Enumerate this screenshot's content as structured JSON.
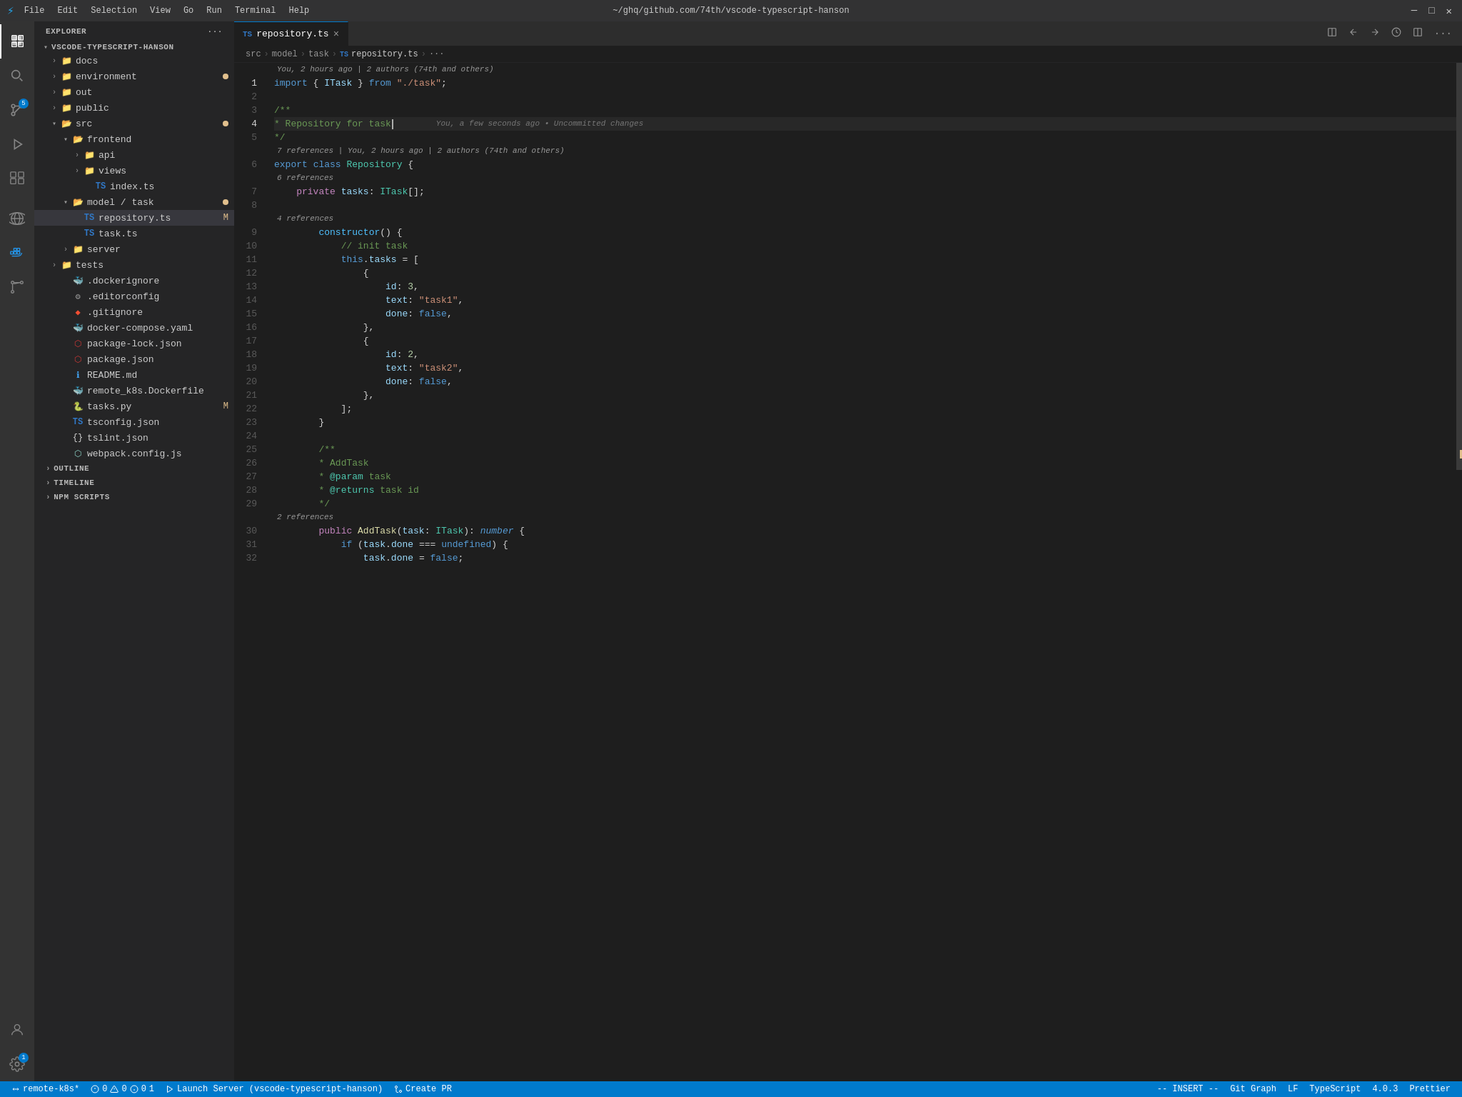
{
  "titleBar": {
    "icon": "⚡",
    "menuItems": [
      "File",
      "Edit",
      "Selection",
      "View",
      "Go",
      "Run",
      "Terminal",
      "Help"
    ],
    "title": "~/ghq/github.com/74th/vscode-typescript-hanson",
    "windowControls": [
      "─",
      "□",
      "✕"
    ]
  },
  "activityBar": {
    "icons": [
      {
        "name": "explorer-icon",
        "symbol": "⬡",
        "active": true
      },
      {
        "name": "search-icon",
        "symbol": "🔍",
        "active": false
      },
      {
        "name": "source-control-icon",
        "symbol": "⑂",
        "active": false,
        "badge": "5"
      },
      {
        "name": "run-icon",
        "symbol": "▷",
        "active": false
      },
      {
        "name": "extensions-icon",
        "symbol": "⊞",
        "active": false
      },
      {
        "name": "database-icon",
        "symbol": "⊗",
        "active": false
      },
      {
        "name": "docker-icon",
        "symbol": "🐳",
        "active": false
      },
      {
        "name": "git-graph-icon",
        "symbol": "⑂",
        "active": false
      }
    ],
    "bottomIcons": [
      {
        "name": "account-icon",
        "symbol": "👤"
      },
      {
        "name": "settings-icon",
        "symbol": "⚙",
        "badge": "1"
      }
    ]
  },
  "sidebar": {
    "header": "Explorer",
    "headerDots": "···",
    "rootFolder": "VSCODE-TYPESCRIPT-HANSON",
    "tree": [
      {
        "type": "folder",
        "name": "docs",
        "level": 1,
        "expanded": false
      },
      {
        "type": "folder",
        "name": "environment",
        "level": 1,
        "expanded": false,
        "dotModified": true
      },
      {
        "type": "folder",
        "name": "out",
        "level": 1,
        "expanded": false
      },
      {
        "type": "folder",
        "name": "public",
        "level": 1,
        "expanded": false
      },
      {
        "type": "folder",
        "name": "src",
        "level": 1,
        "expanded": true,
        "dotModified": true
      },
      {
        "type": "folder",
        "name": "frontend",
        "level": 2,
        "expanded": true
      },
      {
        "type": "folder",
        "name": "api",
        "level": 3,
        "expanded": false
      },
      {
        "type": "folder",
        "name": "views",
        "level": 3,
        "expanded": false
      },
      {
        "type": "file",
        "name": "index.ts",
        "icon": "ts",
        "level": 3
      },
      {
        "type": "folder",
        "name": "model / task",
        "level": 2,
        "expanded": true,
        "dotModified": true
      },
      {
        "type": "file",
        "name": "repository.ts",
        "icon": "ts",
        "level": 3,
        "active": true,
        "modified": "M"
      },
      {
        "type": "file",
        "name": "task.ts",
        "icon": "ts",
        "level": 3
      },
      {
        "type": "folder",
        "name": "server",
        "level": 2,
        "expanded": false
      },
      {
        "type": "folder",
        "name": "tests",
        "level": 1,
        "expanded": false
      },
      {
        "type": "file",
        "name": ".dockerignore",
        "icon": "docker",
        "level": 1
      },
      {
        "type": "file",
        "name": ".editorconfig",
        "icon": "gear",
        "level": 1
      },
      {
        "type": "file",
        "name": ".gitignore",
        "icon": "git",
        "level": 1
      },
      {
        "type": "file",
        "name": "docker-compose.yaml",
        "icon": "docker",
        "level": 1
      },
      {
        "type": "file",
        "name": "package-lock.json",
        "icon": "pkg",
        "level": 1
      },
      {
        "type": "file",
        "name": "package.json",
        "icon": "pkg",
        "level": 1
      },
      {
        "type": "file",
        "name": "README.md",
        "icon": "md",
        "level": 1
      },
      {
        "type": "file",
        "name": "remote_k8s.Dockerfile",
        "icon": "docker",
        "level": 1
      },
      {
        "type": "file",
        "name": "tasks.py",
        "icon": "py",
        "level": 1,
        "modified": "M"
      },
      {
        "type": "file",
        "name": "tsconfig.json",
        "icon": "ts",
        "level": 1
      },
      {
        "type": "file",
        "name": "tslint.json",
        "icon": "braces",
        "level": 1
      },
      {
        "type": "file",
        "name": "webpack.config.js",
        "icon": "webpack",
        "level": 1
      }
    ],
    "sections": [
      {
        "name": "OUTLINE"
      },
      {
        "name": "TIMELINE"
      },
      {
        "name": "NPM SCRIPTS"
      }
    ]
  },
  "editor": {
    "tab": {
      "icon": "ts",
      "name": "repository.ts",
      "close": "×"
    },
    "breadcrumb": [
      "src",
      ">",
      "model",
      ">",
      "task",
      ">",
      "repository.ts",
      ">",
      "···"
    ],
    "blameInfo1": "You, 2 hours ago | 2 authors (74th and others)",
    "blameInfo2": "7 references | You, 2 hours ago | 2 authors (74th and others)",
    "blameInfo3": "6 references",
    "blameInfo4": "4 references",
    "blameInfo5": "2 references",
    "activeLineBlame": "You, a few seconds ago • Uncommitted changes",
    "lines": [
      {
        "num": 1,
        "tokens": [
          {
            "t": "kw",
            "v": "import"
          },
          {
            "t": "plain",
            "v": " { "
          },
          {
            "t": "prop",
            "v": "ITask"
          },
          {
            "t": "plain",
            "v": " } "
          },
          {
            "t": "kw",
            "v": "from"
          },
          {
            "t": "plain",
            "v": " "
          },
          {
            "t": "str",
            "v": "\"./task\""
          },
          {
            "t": "plain",
            "v": ";"
          }
        ]
      },
      {
        "num": 2,
        "tokens": []
      },
      {
        "num": 3,
        "tokens": [
          {
            "t": "cmt",
            "v": "/**"
          }
        ]
      },
      {
        "num": 4,
        "tokens": [
          {
            "t": "cmt",
            "v": "* Repository for task"
          },
          {
            "t": "cursor",
            "v": ""
          },
          {
            "t": "plain",
            "v": "    "
          },
          {
            "t": "git-blame",
            "v": "You, a few seconds ago • Uncommitted changes"
          }
        ],
        "active": true
      },
      {
        "num": 5,
        "tokens": [
          {
            "t": "cmt",
            "v": "*/"
          }
        ]
      },
      {
        "num": 6,
        "tokens": [
          {
            "t": "kw",
            "v": "export"
          },
          {
            "t": "plain",
            "v": " "
          },
          {
            "t": "kw",
            "v": "class"
          },
          {
            "t": "plain",
            "v": " "
          },
          {
            "t": "cls",
            "v": "Repository"
          },
          {
            "t": "plain",
            "v": " {"
          }
        ]
      },
      {
        "num": 7,
        "tokens": [
          {
            "t": "plain",
            "v": "    "
          },
          {
            "t": "kw2",
            "v": "private"
          },
          {
            "t": "plain",
            "v": " "
          },
          {
            "t": "prop",
            "v": "tasks"
          },
          {
            "t": "plain",
            "v": ": "
          },
          {
            "t": "cls",
            "v": "ITask"
          },
          {
            "t": "plain",
            "v": "[];"
          }
        ]
      },
      {
        "num": 8,
        "tokens": []
      },
      {
        "num": 9,
        "tokens": [
          {
            "t": "plain",
            "v": "        "
          },
          {
            "t": "dec",
            "v": "constructor"
          },
          {
            "t": "plain",
            "v": "() {"
          }
        ]
      },
      {
        "num": 10,
        "tokens": [
          {
            "t": "plain",
            "v": "            "
          },
          {
            "t": "cmt",
            "v": "// init task"
          }
        ]
      },
      {
        "num": 11,
        "tokens": [
          {
            "t": "plain",
            "v": "            "
          },
          {
            "t": "kw",
            "v": "this"
          },
          {
            "t": "plain",
            "v": "."
          },
          {
            "t": "prop",
            "v": "tasks"
          },
          {
            "t": "plain",
            "v": " = ["
          }
        ]
      },
      {
        "num": 12,
        "tokens": [
          {
            "t": "plain",
            "v": "                {"
          }
        ]
      },
      {
        "num": 13,
        "tokens": [
          {
            "t": "plain",
            "v": "                    "
          },
          {
            "t": "prop",
            "v": "id"
          },
          {
            "t": "plain",
            "v": ": "
          },
          {
            "t": "num",
            "v": "3"
          },
          {
            "t": "plain",
            "v": ","
          }
        ]
      },
      {
        "num": 14,
        "tokens": [
          {
            "t": "plain",
            "v": "                    "
          },
          {
            "t": "prop",
            "v": "text"
          },
          {
            "t": "plain",
            "v": ": "
          },
          {
            "t": "str",
            "v": "\"task1\""
          },
          {
            "t": "plain",
            "v": ","
          }
        ]
      },
      {
        "num": 15,
        "tokens": [
          {
            "t": "plain",
            "v": "                    "
          },
          {
            "t": "prop",
            "v": "done"
          },
          {
            "t": "plain",
            "v": ": "
          },
          {
            "t": "kw",
            "v": "false"
          },
          {
            "t": "plain",
            "v": ","
          }
        ]
      },
      {
        "num": 16,
        "tokens": [
          {
            "t": "plain",
            "v": "                },"
          }
        ]
      },
      {
        "num": 17,
        "tokens": [
          {
            "t": "plain",
            "v": "                {"
          }
        ]
      },
      {
        "num": 18,
        "tokens": [
          {
            "t": "plain",
            "v": "                    "
          },
          {
            "t": "prop",
            "v": "id"
          },
          {
            "t": "plain",
            "v": ": "
          },
          {
            "t": "num",
            "v": "2"
          },
          {
            "t": "plain",
            "v": ","
          }
        ]
      },
      {
        "num": 19,
        "tokens": [
          {
            "t": "plain",
            "v": "                    "
          },
          {
            "t": "prop",
            "v": "text"
          },
          {
            "t": "plain",
            "v": ": "
          },
          {
            "t": "str",
            "v": "\"task2\""
          },
          {
            "t": "plain",
            "v": ","
          }
        ]
      },
      {
        "num": 20,
        "tokens": [
          {
            "t": "plain",
            "v": "                    "
          },
          {
            "t": "prop",
            "v": "done"
          },
          {
            "t": "plain",
            "v": ": "
          },
          {
            "t": "kw",
            "v": "false"
          },
          {
            "t": "plain",
            "v": ","
          }
        ]
      },
      {
        "num": 21,
        "tokens": [
          {
            "t": "plain",
            "v": "                },"
          }
        ]
      },
      {
        "num": 22,
        "tokens": [
          {
            "t": "plain",
            "v": "            ];"
          }
        ]
      },
      {
        "num": 23,
        "tokens": [
          {
            "t": "plain",
            "v": "        }"
          }
        ]
      },
      {
        "num": 24,
        "tokens": []
      },
      {
        "num": 25,
        "tokens": [
          {
            "t": "plain",
            "v": "        "
          },
          {
            "t": "cmt",
            "v": "/**"
          }
        ]
      },
      {
        "num": 26,
        "tokens": [
          {
            "t": "plain",
            "v": "        "
          },
          {
            "t": "cmt",
            "v": "* AddTask"
          }
        ]
      },
      {
        "num": 27,
        "tokens": [
          {
            "t": "plain",
            "v": "        "
          },
          {
            "t": "cmt",
            "v": "* "
          },
          {
            "t": "cmt",
            "v": "@param"
          },
          {
            "t": "cmt",
            "v": " task"
          }
        ]
      },
      {
        "num": 28,
        "tokens": [
          {
            "t": "plain",
            "v": "        "
          },
          {
            "t": "cmt",
            "v": "* "
          },
          {
            "t": "cmt",
            "v": "@returns"
          },
          {
            "t": "cmt",
            "v": " task id"
          }
        ]
      },
      {
        "num": 29,
        "tokens": [
          {
            "t": "plain",
            "v": "        "
          },
          {
            "t": "cmt",
            "v": "*/"
          }
        ]
      },
      {
        "num": 30,
        "tokens": [
          {
            "t": "plain",
            "v": "        "
          },
          {
            "t": "kw2",
            "v": "public"
          },
          {
            "t": "plain",
            "v": " "
          },
          {
            "t": "fn",
            "v": "AddTask"
          },
          {
            "t": "plain",
            "v": "("
          },
          {
            "t": "param",
            "v": "task"
          },
          {
            "t": "plain",
            "v": ": "
          },
          {
            "t": "cls",
            "v": "ITask"
          },
          {
            "t": "plain",
            "v": "): "
          },
          {
            "t": "ret",
            "v": "number"
          },
          {
            "t": "plain",
            "v": " {"
          }
        ]
      },
      {
        "num": 31,
        "tokens": [
          {
            "t": "plain",
            "v": "            "
          },
          {
            "t": "kw",
            "v": "if"
          },
          {
            "t": "plain",
            "v": " ("
          },
          {
            "t": "prop",
            "v": "task"
          },
          {
            "t": "plain",
            "v": "."
          },
          {
            "t": "prop",
            "v": "done"
          },
          {
            "t": "plain",
            "v": " "
          },
          {
            "t": "op",
            "v": "==="
          },
          {
            "t": "plain",
            "v": " "
          },
          {
            "t": "kw",
            "v": "undefined"
          },
          {
            "t": "plain",
            "v": ") {"
          }
        ]
      },
      {
        "num": 32,
        "tokens": [
          {
            "t": "plain",
            "v": "                "
          },
          {
            "t": "prop",
            "v": "task"
          },
          {
            "t": "plain",
            "v": "."
          },
          {
            "t": "prop",
            "v": "done"
          },
          {
            "t": "plain",
            "v": " = "
          },
          {
            "t": "kw",
            "v": "false"
          },
          {
            "t": "plain",
            "v": ";"
          }
        ]
      }
    ]
  },
  "statusBar": {
    "remote": "remote-k8s*",
    "errors": "0",
    "warnings": "0",
    "info": "0",
    "hints": "1",
    "launchServer": "Launch Server (vscode-typescript-hanson)",
    "createPR": "Create PR",
    "insertMode": "-- INSERT --",
    "gitGraph": "Git Graph",
    "lineEnding": "LF",
    "language": "TypeScript",
    "version": "4.0.3",
    "formatter": "Prettier"
  }
}
